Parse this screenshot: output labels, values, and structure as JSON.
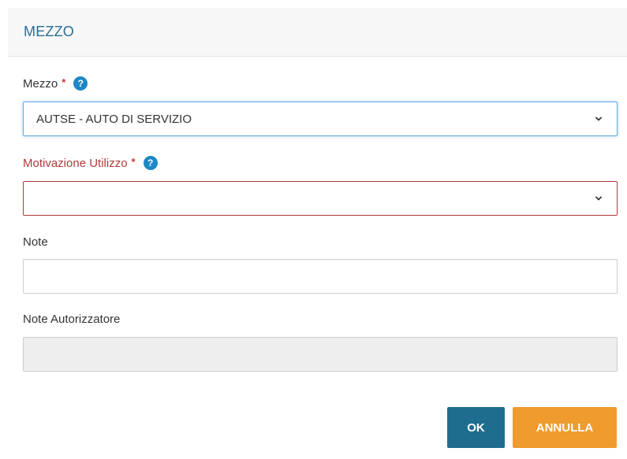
{
  "dialog": {
    "title": "MEZZO"
  },
  "fields": {
    "mezzo": {
      "label": "Mezzo",
      "required_mark": "*",
      "help_icon": "?",
      "value": "AUTSE - AUTO DI SERVIZIO"
    },
    "motivazione": {
      "label": "Motivazione Utilizzo",
      "required_mark": "*",
      "help_icon": "?",
      "value": ""
    },
    "note": {
      "label": "Note",
      "value": ""
    },
    "note_autorizzatore": {
      "label": "Note Autorizzatore",
      "value": ""
    }
  },
  "buttons": {
    "ok_label": "OK",
    "cancel_label": "ANNULLA"
  },
  "colors": {
    "title": "#2a6f97",
    "help_icon": "#1e88c7",
    "error": "#b0393c",
    "ok_button": "#1f6d8e",
    "cancel_button": "#ef9b2d"
  },
  "icons": {
    "help": "question-circle-icon",
    "dropdown": "chevron-down-icon"
  }
}
